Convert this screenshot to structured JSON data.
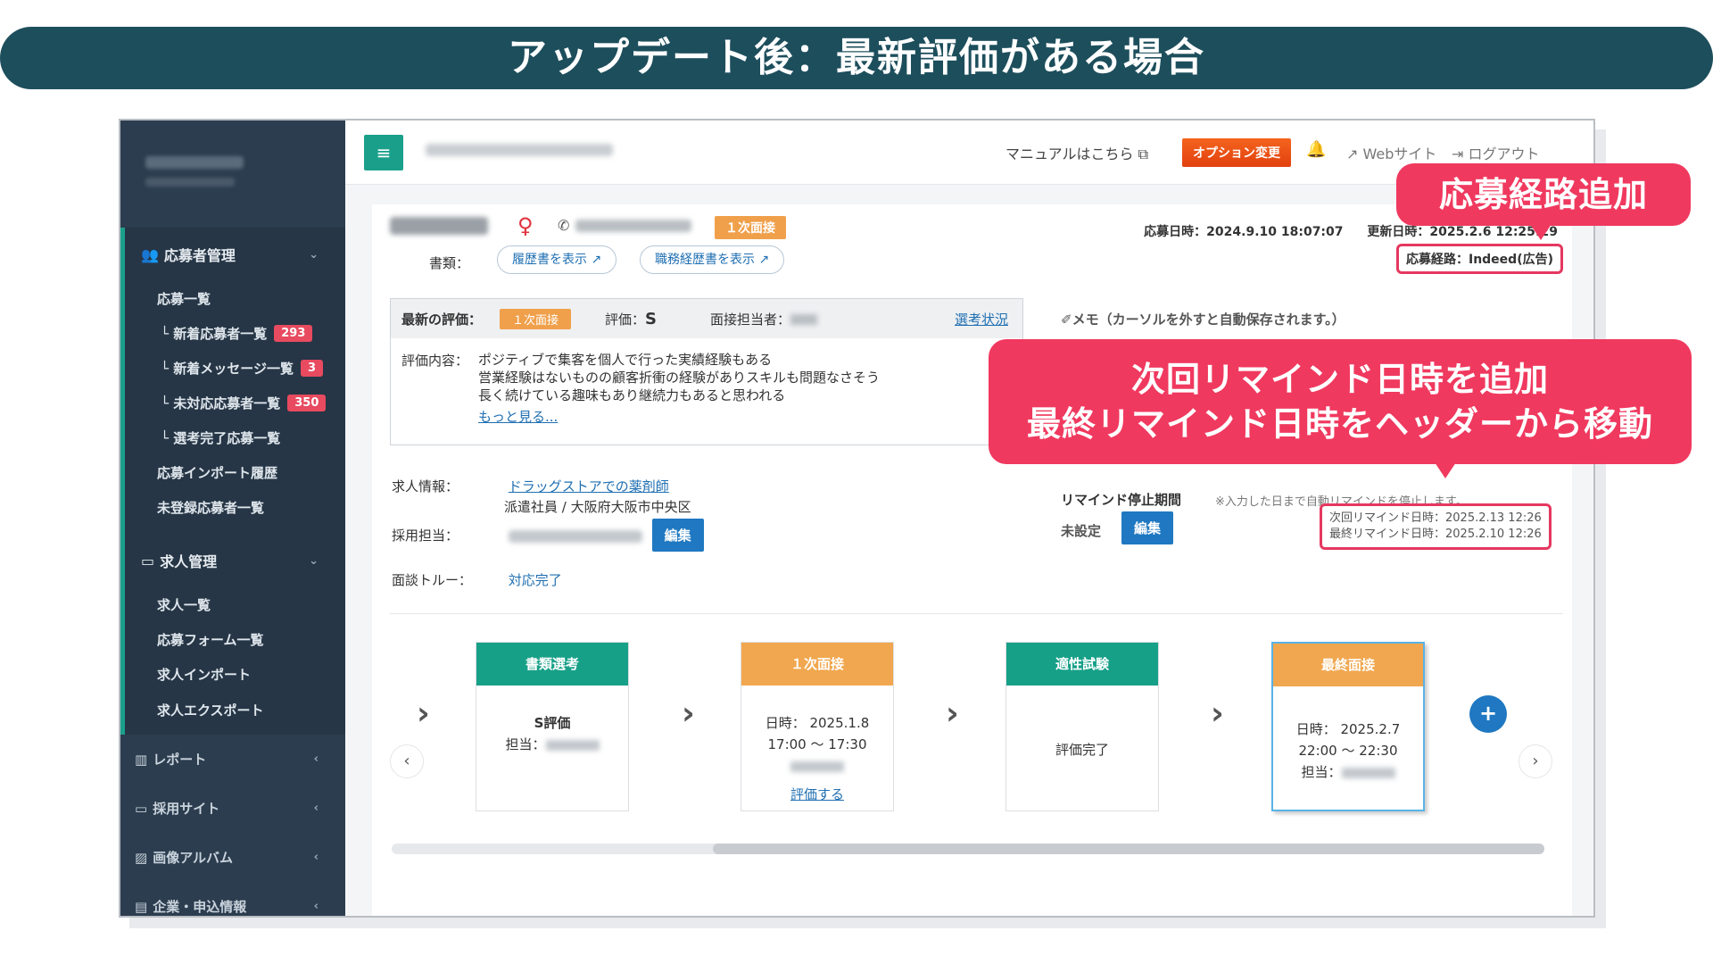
{
  "banner": {
    "title": "アップデート後：最新評価がある場合"
  },
  "sidebar": {
    "group1": {
      "title": "応募者管理",
      "icon": "users-icon"
    },
    "items": [
      {
        "label": "応募一覧"
      },
      {
        "label": "└ 新着応募者一覧",
        "badge": "293"
      },
      {
        "label": "└ 新着メッセージ一覧",
        "badge": "3"
      },
      {
        "label": "└ 未対応応募者一覧",
        "badge": "350"
      },
      {
        "label": "└ 選考完了応募一覧"
      },
      {
        "label": "応募インポート履歴"
      },
      {
        "label": "未登録応募者一覧"
      }
    ],
    "group2": {
      "title": "求人管理",
      "icon": "briefcase-icon"
    },
    "items2": [
      {
        "label": "求人一覧"
      },
      {
        "label": "応募フォーム一覧"
      },
      {
        "label": "求人インポート"
      },
      {
        "label": "求人エクスポート"
      }
    ],
    "bottom": [
      {
        "label": "レポート",
        "icon": "chart-icon"
      },
      {
        "label": "採用サイト",
        "icon": "monitor-icon"
      },
      {
        "label": "画像アルバム",
        "icon": "image-icon"
      },
      {
        "label": "企業・申込情報",
        "icon": "building-icon"
      }
    ]
  },
  "topbar": {
    "menu_icon": "≡",
    "manual": "マニュアルはこちら",
    "option": "オプション変更",
    "website": "Webサイト",
    "logout": "ログアウト"
  },
  "candidate": {
    "stage": "１次面接",
    "docs_label": "書類：",
    "resume_btn": "履歴書を表示",
    "career_btn": "職務経歴書を表示",
    "applied": "応募日時：2024.9.10 18:07:07",
    "updated": "更新日時：2025.2.6 12:25:29",
    "route": "応募経路：Indeed(広告)"
  },
  "evaluation": {
    "label": "最新の評価：",
    "stage": "１次面接",
    "score_label": "評価：",
    "score": "S",
    "interviewer_label": "面接担当者：",
    "status_link": "選考状況",
    "content_label": "評価内容：",
    "lines": [
      "ポジティブで集客を個人で行った実績経験もある",
      "営業経験はないものの顧客折衝の経験がありスキルも問題なさそう",
      "長く続けている趣味もあり継続力もあると思われる"
    ],
    "more": "もっと見る..."
  },
  "memo": "✐メモ（カーソルを外すと自動保存されます。）",
  "job": {
    "label": "求人情報：",
    "title": "ドラッグストアでの薬剤師",
    "sub": "派遣社員 / 大阪府大阪市中央区",
    "recruiter_label": "採用担当：",
    "edit": "編集",
    "meeting_label": "面談トルー：",
    "meeting_value": "対応完了"
  },
  "remind": {
    "title": "リマインド停止期間",
    "note": "※入力した日まで自動リマインドを停止します。",
    "unset": "未設定",
    "edit": "編集",
    "next": "次回リマインド日時：2025.2.13 12:26",
    "last": "最終リマインド日時：2025.2.10 12:26"
  },
  "flow": [
    {
      "title": "書類選考",
      "color": "#17a088",
      "line1": "S評価",
      "line2": "担当："
    },
    {
      "title": "１次面接",
      "color": "#f1a74f",
      "line1": "日時： 2025.1.8",
      "line2": "17:00 〜 17:30",
      "link": "評価する"
    },
    {
      "title": "適性試験",
      "color": "#17a088",
      "line1": "評価完了"
    },
    {
      "title": "最終面接",
      "color": "#f1a74f",
      "line1": "日時： 2025.2.7",
      "line2": "22:00 〜 22:30",
      "line3": "担当："
    }
  ],
  "callouts": {
    "route": "応募経路追加",
    "remind_l1": "次回リマインド日時を追加",
    "remind_l2": "最終リマインド日時をヘッダーから移動"
  }
}
